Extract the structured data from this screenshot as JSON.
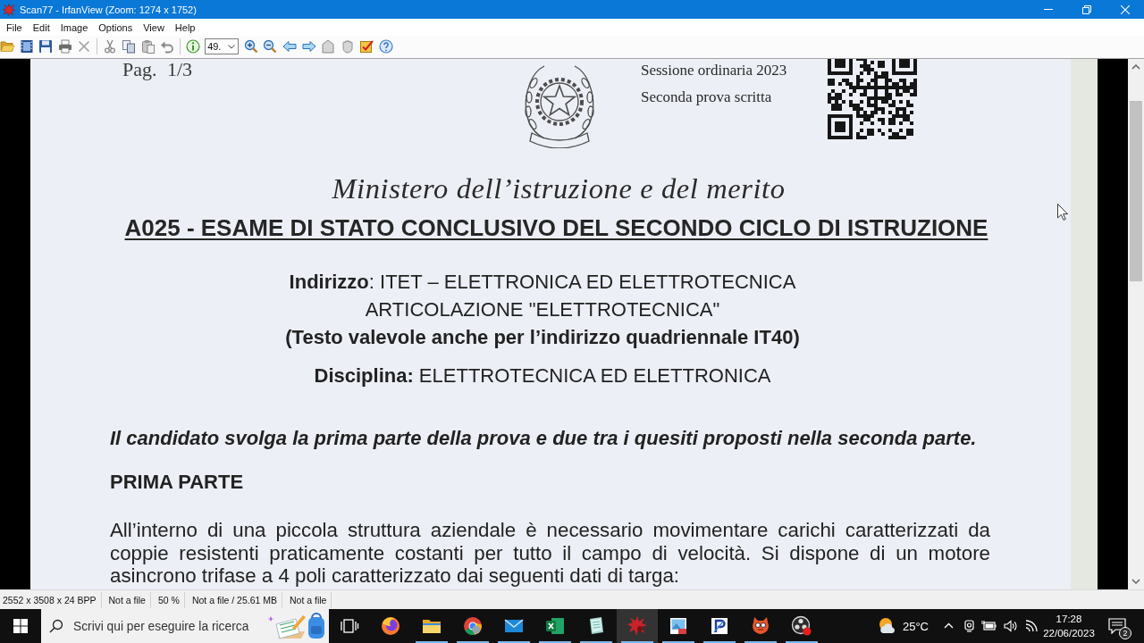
{
  "window": {
    "title": "Scan77 - IrfanView (Zoom: 1274 x 1752)"
  },
  "menu": [
    "File",
    "Edit",
    "Image",
    "Options",
    "View",
    "Help"
  ],
  "toolbar": {
    "zoom_value": "49."
  },
  "document": {
    "page_label": "Pag. 1/3",
    "session": [
      "Sessione ordinaria 2023",
      "Seconda prova scritta"
    ],
    "ministry": "Ministero dell’istruzione e del merito",
    "exam_title": "A025 - ESAME DI STATO CONCLUSIVO DEL SECONDO CICLO DI ISTRUZIONE",
    "address": "**Indirizzo**: ITET – ELETTRONICA ED ELETTROTECNICA",
    "articulation": "ARTICOLAZIONE \"ELETTROTECNICA\"",
    "note": "(Testo valevole anche per l’indirizzo quadriennale IT40)",
    "discipline": "**Disciplina:** ELETTROTECNICA ED ELETTRONICA",
    "instructions": "Il candidato svolga la prima parte della prova e due tra i quesiti proposti nella seconda parte.",
    "section_heading": "PRIMA PARTE",
    "paragraph": "All’interno di una piccola struttura aziendale è necessario movimentare carichi caratterizzati da coppie resistenti praticamente costanti per tutto il campo di velocità. Si dispone di un motore asincrono trifase a 4 poli caratterizzato dai seguenti dati di targa:"
  },
  "status_bar": [
    "2552 x 3508 x 24 BPP",
    "Not a file",
    "50 %",
    "Not a file / 25.61 MB",
    "Not a file"
  ],
  "taskbar": {
    "search": {
      "placeholder": "Scrivi qui per eseguire la ricerca"
    },
    "apps": [
      {
        "kind": "globe",
        "running": false,
        "selected": false
      },
      {
        "kind": "folder",
        "running": true,
        "selected": false
      },
      {
        "kind": "wheel",
        "running": true,
        "selected": false
      },
      {
        "kind": "envelope",
        "running": true,
        "selected": false
      },
      {
        "kind": "spreadsheet",
        "running": true,
        "selected": false
      },
      {
        "kind": "notepad",
        "running": true,
        "selected": false
      },
      {
        "kind": "splat",
        "running": true,
        "selected": true
      },
      {
        "kind": "picture",
        "running": true,
        "selected": false
      },
      {
        "kind": "tile",
        "running": true,
        "selected": false
      },
      {
        "kind": "cat",
        "running": true,
        "selected": false
      },
      {
        "kind": "disc",
        "running": true,
        "selected": false
      }
    ],
    "weather": {
      "temperature": "25°C"
    },
    "clock": {
      "time": "17:28",
      "date": "22/06/2023"
    },
    "notifications": {
      "count": "2"
    }
  }
}
